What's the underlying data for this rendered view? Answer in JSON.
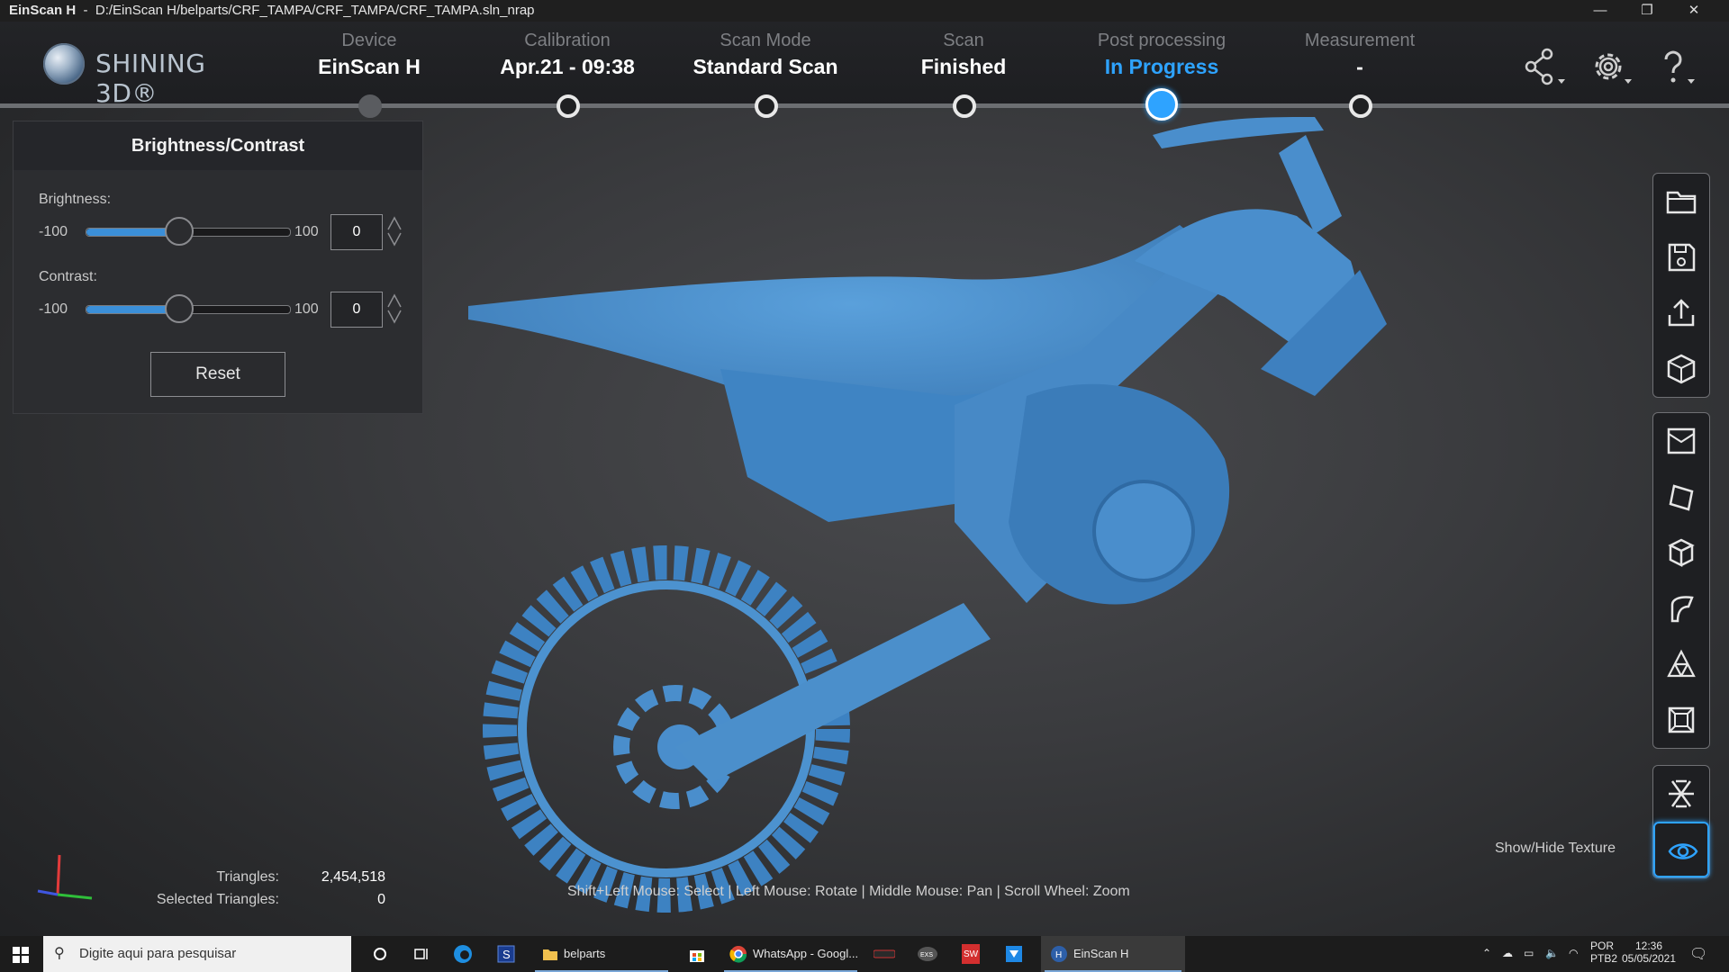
{
  "window": {
    "app_name": "EinScan H",
    "separator": "-",
    "file_path": "D:/EinScan H/belparts/CRF_TAMPA/CRF_TAMPA/CRF_TAMPA.sln_nrap",
    "minimize": "—",
    "restore": "❐",
    "close": "✕"
  },
  "header": {
    "brand": "SHINING 3D®",
    "steps": [
      {
        "label": "Device",
        "value": "EinScan H",
        "state": "done"
      },
      {
        "label": "Calibration",
        "value": "Apr.21 - 09:38",
        "state": "complete"
      },
      {
        "label": "Scan Mode",
        "value": "Standard Scan",
        "state": "complete"
      },
      {
        "label": "Scan",
        "value": "Finished",
        "state": "complete"
      },
      {
        "label": "Post processing",
        "value": "In Progress",
        "state": "active"
      },
      {
        "label": "Measurement",
        "value": "-",
        "state": "pending"
      }
    ],
    "icons": [
      "share-icon",
      "settings-icon",
      "help-icon"
    ]
  },
  "panel": {
    "title": "Brightness/Contrast",
    "brightness": {
      "label": "Brightness:",
      "min": "-100",
      "max": "100",
      "value": "0"
    },
    "contrast": {
      "label": "Contrast:",
      "min": "-100",
      "max": "100",
      "value": "0"
    },
    "reset_label": "Reset"
  },
  "toolbar": {
    "groups": [
      [
        "open-folder-icon",
        "save-icon",
        "export-icon",
        "mesh-view-icon"
      ],
      [
        "box-icon",
        "rotate-icon",
        "cube-icon",
        "curvature-icon",
        "mesh-triangle-icon",
        "fill-holes-icon"
      ],
      [
        "hide-icon",
        "show-texture-icon"
      ]
    ],
    "show_hide_texture_label": "Show/Hide Texture"
  },
  "stats": {
    "triangles_label": "Triangles:",
    "triangles_value": "2,454,518",
    "selected_label": "Selected Triangles:",
    "selected_value": "0"
  },
  "hint": "Shift+Left Mouse: Select | Left Mouse: Rotate | Middle Mouse: Pan | Scroll Wheel: Zoom",
  "taskbar": {
    "search_placeholder": "Digite aqui para pesquisar",
    "apps": [
      {
        "name": "belparts",
        "icon": "folder-icon"
      },
      {
        "name": "WhatsApp - Googl...",
        "icon": "chrome-icon"
      },
      {
        "name": "EinScan H",
        "icon": "einscan-icon"
      }
    ],
    "tray": {
      "lang": "POR",
      "layout": "PTB2",
      "time": "12:36",
      "date": "05/05/2021"
    }
  }
}
